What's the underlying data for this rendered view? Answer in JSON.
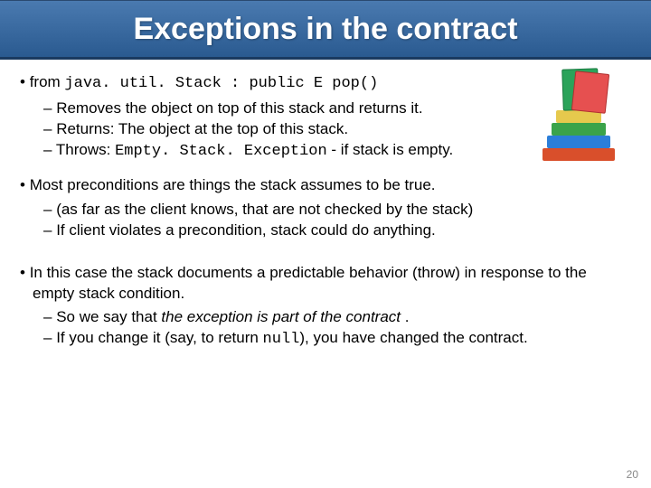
{
  "title": "Exceptions in the contract",
  "line1_pre": "from ",
  "line1_code": "java. util. Stack : public E pop()",
  "sub1a": "Removes the object on top of this stack and returns it.",
  "sub1b": "Returns: The object at the top of this stack.",
  "sub1c_pre": "Throws: ",
  "sub1c_code": "Empty. Stack. Exception",
  "sub1c_post": " - if stack is empty.",
  "line2": "Most preconditions are things the stack assumes to be true.",
  "sub2a": "(as far as the client knows, that are not checked by the stack)",
  "sub2b": "If client violates a precondition, stack could do anything.",
  "line3": "In this case the stack documents a predictable behavior (throw) in response to the empty stack condition.",
  "sub3a_pre": "So we say that ",
  "sub3a_italic": "the exception is part of the contract",
  "sub3a_post": " .",
  "sub3b_pre": "If you change it (say, to return ",
  "sub3b_code": "null",
  "sub3b_post": "), you have changed the contract.",
  "page_number": "20"
}
